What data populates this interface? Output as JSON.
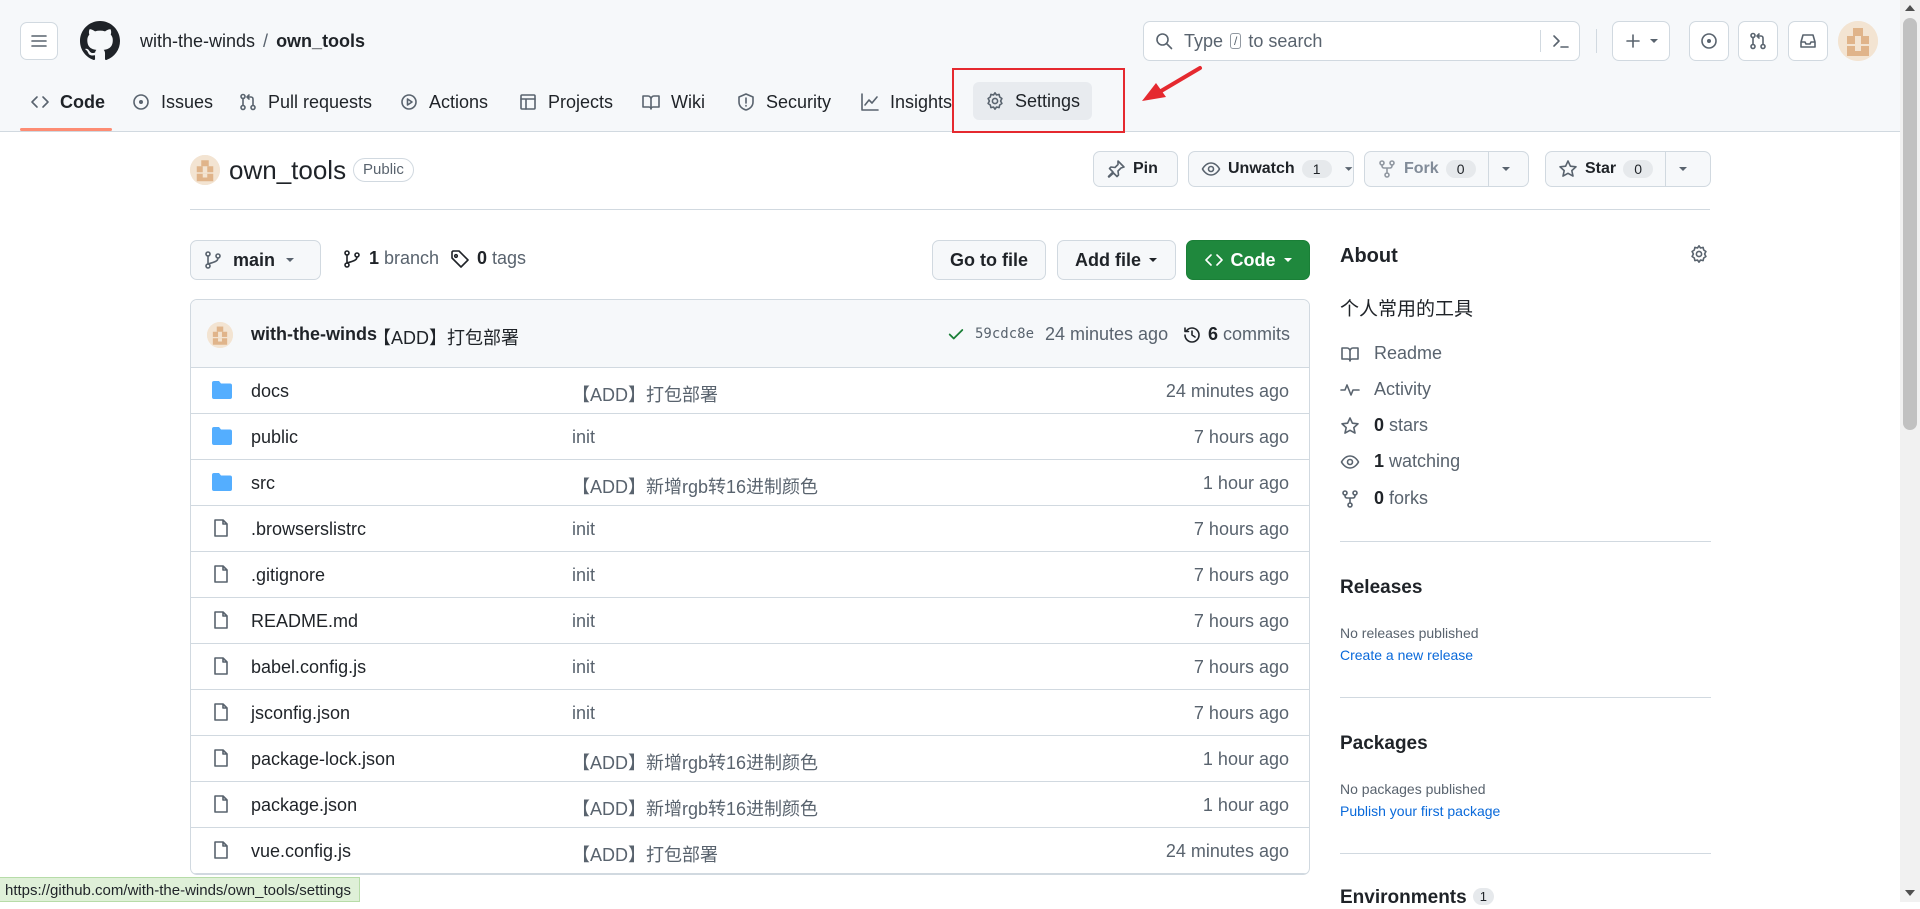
{
  "header": {
    "owner": "with-the-winds",
    "separator": "/",
    "repo": "own_tools",
    "search_placeholder_before": "Type",
    "search_placeholder_key": "/",
    "search_placeholder_after": "to search"
  },
  "tabs": [
    {
      "label": "Code",
      "icon": "code-icon"
    },
    {
      "label": "Issues",
      "icon": "issue-icon"
    },
    {
      "label": "Pull requests",
      "icon": "pull-request-icon"
    },
    {
      "label": "Actions",
      "icon": "play-icon"
    },
    {
      "label": "Projects",
      "icon": "table-icon"
    },
    {
      "label": "Wiki",
      "icon": "book-icon"
    },
    {
      "label": "Security",
      "icon": "shield-icon"
    },
    {
      "label": "Insights",
      "icon": "graph-icon"
    },
    {
      "label": "Settings",
      "icon": "gear-icon"
    }
  ],
  "repo_header": {
    "name": "own_tools",
    "visibility": "Public",
    "pin_label": "Pin",
    "watch_label": "Unwatch",
    "watch_count": "1",
    "fork_label": "Fork",
    "fork_count": "0",
    "star_label": "Star",
    "star_count": "0"
  },
  "branch_bar": {
    "branch": "main",
    "branch_count": "1",
    "branch_word": "branch",
    "tag_count": "0",
    "tag_word": "tags",
    "go_to_file": "Go to file",
    "add_file": "Add file",
    "code": "Code"
  },
  "latest_commit": {
    "author": "with-the-winds",
    "message": "【ADD】打包部署",
    "hash": "59cdc8e",
    "time": "24 minutes ago",
    "commit_count": "6",
    "commit_word": "commits"
  },
  "files": [
    {
      "name": "docs",
      "type": "folder",
      "message": "【ADD】打包部署",
      "time": "24 minutes ago"
    },
    {
      "name": "public",
      "type": "folder",
      "message": "init",
      "time": "7 hours ago"
    },
    {
      "name": "src",
      "type": "folder",
      "message": "【ADD】新增rgb转16进制颜色",
      "time": "1 hour ago"
    },
    {
      "name": ".browserslistrc",
      "type": "file",
      "message": "init",
      "time": "7 hours ago"
    },
    {
      "name": ".gitignore",
      "type": "file",
      "message": "init",
      "time": "7 hours ago"
    },
    {
      "name": "README.md",
      "type": "file",
      "message": "init",
      "time": "7 hours ago"
    },
    {
      "name": "babel.config.js",
      "type": "file",
      "message": "init",
      "time": "7 hours ago"
    },
    {
      "name": "jsconfig.json",
      "type": "file",
      "message": "init",
      "time": "7 hours ago"
    },
    {
      "name": "package-lock.json",
      "type": "file",
      "message": "【ADD】新增rgb转16进制颜色",
      "time": "1 hour ago"
    },
    {
      "name": "package.json",
      "type": "file",
      "message": "【ADD】新增rgb转16进制颜色",
      "time": "1 hour ago"
    },
    {
      "name": "vue.config.js",
      "type": "file",
      "message": "【ADD】打包部署",
      "time": "24 minutes ago"
    }
  ],
  "sidebar": {
    "about_title": "About",
    "description": "个人常用的工具",
    "readme": "Readme",
    "activity": "Activity",
    "stars_count": "0",
    "stars_word": "stars",
    "watching_count": "1",
    "watching_word": "watching",
    "forks_count": "0",
    "forks_word": "forks",
    "releases_title": "Releases",
    "releases_empty": "No releases published",
    "releases_link": "Create a new release",
    "packages_title": "Packages",
    "packages_empty": "No packages published",
    "packages_link": "Publish your first package",
    "environments_title": "Environments",
    "environments_count": "1"
  },
  "status_url": "https://github.com/with-the-winds/own_tools/settings",
  "colors": {
    "accent_green": "#1f883d",
    "link_blue": "#0969da",
    "annotation_red": "#e5292f",
    "tab_underline": "#fd8c73",
    "folder_blue": "#54aeff"
  }
}
